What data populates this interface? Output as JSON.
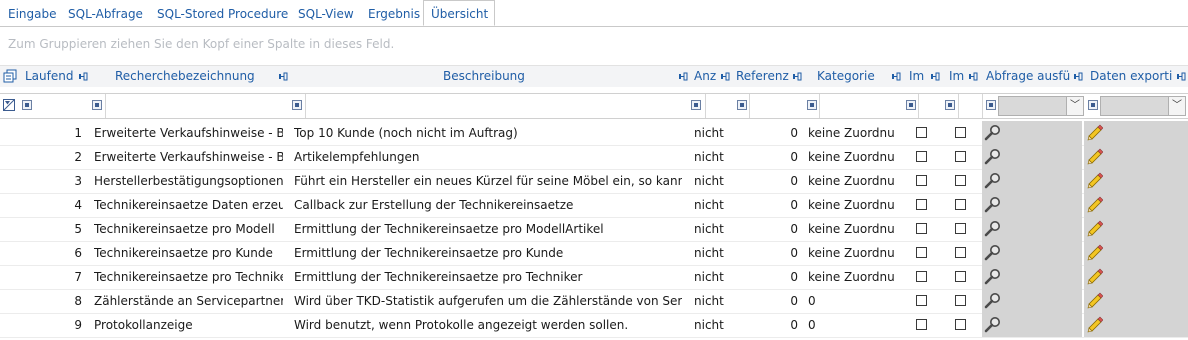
{
  "tabs": [
    {
      "label": "Eingabe"
    },
    {
      "label": "SQL-Abfrage"
    },
    {
      "label": "SQL-Stored Procedure"
    },
    {
      "label": "SQL-View"
    },
    {
      "label": "Ergebnis"
    },
    {
      "label": "Übersicht"
    }
  ],
  "active_tab": "Übersicht",
  "group_hint": "Zum Gruppieren ziehen Sie den Kopf einer Spalte in dieses Feld.",
  "columns": {
    "laufend": "Laufend",
    "recherche": "Recherchebezeichnung",
    "beschreibung": "Beschreibung",
    "anz": "Anz",
    "referenz": "Referenz",
    "kategorie": "Kategorie",
    "im1": "Im",
    "im2": "Im",
    "abfrage": "Abfrage ausfü",
    "export": "Daten exporti"
  },
  "icons": {
    "chooser": "column-chooser-icon",
    "filter_clear": "filter-clear-icon",
    "pin": "pin-icon",
    "filter": "filter-operator-icon",
    "dropdown": "chevron-down-icon",
    "abfrage": "magnifier-icon",
    "export": "pencil-icon"
  },
  "rows": [
    {
      "laufend": "1",
      "recherche": "Erweiterte Verkaufshinweise - Bo",
      "beschreibung": "Top 10 Kunde (noch nicht im Auftrag)",
      "anz": "nicht",
      "referenz": "0",
      "kategorie": "keine Zuordnu"
    },
    {
      "laufend": "2",
      "recherche": "Erweiterte Verkaufshinweise - Bo",
      "beschreibung": "Artikelempfehlungen",
      "anz": "nicht",
      "referenz": "0",
      "kategorie": "keine Zuordnu"
    },
    {
      "laufend": "3",
      "recherche": "Herstellerbestätigungsoptionen",
      "beschreibung": "Führt ein Hersteller ein neues Kürzel für seine Möbel ein, so kann hi",
      "anz": "nicht",
      "referenz": "0",
      "kategorie": "keine Zuordnu"
    },
    {
      "laufend": "4",
      "recherche": "Technikereinsaetze Daten erzeug",
      "beschreibung": "Callback zur Erstellung der Technikereinsaetze",
      "anz": "nicht",
      "referenz": "0",
      "kategorie": "keine Zuordnu"
    },
    {
      "laufend": "5",
      "recherche": "Technikereinsaetze pro Modell",
      "beschreibung": "Ermittlung der Technikereinsaetze pro ModellArtikel",
      "anz": "nicht",
      "referenz": "0",
      "kategorie": "keine Zuordnu"
    },
    {
      "laufend": "6",
      "recherche": "Technikereinsaetze pro Kunde",
      "beschreibung": "Ermittlung der Technikereinsaetze pro Kunde",
      "anz": "nicht",
      "referenz": "0",
      "kategorie": "keine Zuordnu"
    },
    {
      "laufend": "7",
      "recherche": "Technikereinsaetze pro Techniker",
      "beschreibung": "Ermittlung der Technikereinsaetze pro Techniker",
      "anz": "nicht",
      "referenz": "0",
      "kategorie": "keine Zuordnu"
    },
    {
      "laufend": "8",
      "recherche": "Zählerstände an Servicepartner",
      "beschreibung": "Wird über TKD-Statistik aufgerufen um die Zählerstände von Service",
      "anz": "nicht",
      "referenz": "0",
      "kategorie": "0"
    },
    {
      "laufend": "9",
      "recherche": "Protokollanzeige",
      "beschreibung": "Wird benutzt, wenn Protokolle angezeigt werden sollen.",
      "anz": "nicht",
      "referenz": "0",
      "kategorie": "0"
    }
  ]
}
